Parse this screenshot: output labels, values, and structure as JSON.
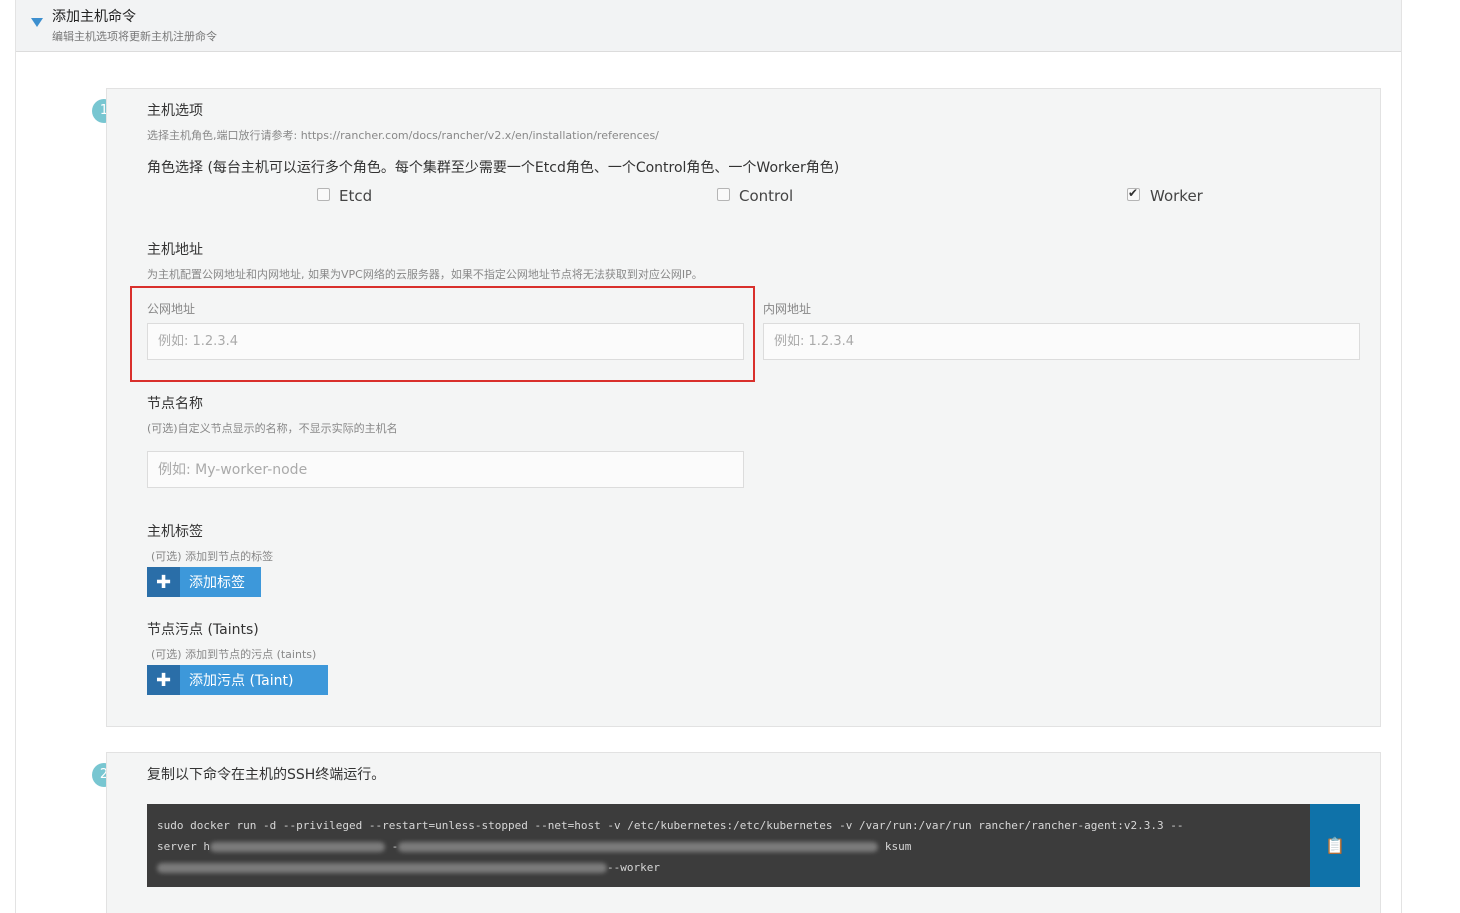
{
  "header": {
    "title": "添加主机命令",
    "subtitle": "编辑主机选项将更新主机注册命令"
  },
  "step1": {
    "badge": "1",
    "host_options": {
      "title": "主机选项",
      "hint": "选择主机角色,端口放行请参考: https://rancher.com/docs/rancher/v2.x/en/installation/references/"
    },
    "roles": {
      "title": "角色选择 (每台主机可以运行多个角色。每个集群至少需要一个Etcd角色、一个Control角色、一个Worker角色)",
      "items": [
        {
          "label": "Etcd",
          "checked": false
        },
        {
          "label": "Control",
          "checked": false
        },
        {
          "label": "Worker",
          "checked": true
        }
      ]
    },
    "address": {
      "title": "主机地址",
      "hint": "为主机配置公网地址和内网地址, 如果为VPC网络的云服务器，如果不指定公网地址节点将无法获取到对应公网IP。",
      "public_label": "公网地址",
      "public_placeholder": "例如: 1.2.3.4",
      "public_value": "",
      "private_label": "内网地址",
      "private_placeholder": "例如: 1.2.3.4",
      "private_value": ""
    },
    "node_name": {
      "title": "节点名称",
      "hint": "(可选)自定义节点显示的名称，不显示实际的主机名",
      "placeholder": "例如: My-worker-node",
      "value": ""
    },
    "labels": {
      "title": "主机标签",
      "hint": "(可选) 添加到节点的标签",
      "button": "添加标签"
    },
    "taints": {
      "title": "节点污点 (Taints)",
      "hint": "(可选) 添加到节点的污点 (taints)",
      "button": "添加污点 (Taint)"
    }
  },
  "step2": {
    "badge": "2",
    "title": "复制以下命令在主机的SSH终端运行。",
    "command_line1": "sudo docker run -d --privileged --restart=unless-stopped --net=host -v /etc/kubernetes:/etc/kubernetes -v /var/run:/var/run rancher/rancher-agent:v2.3.3 --",
    "command_line2_start": "server h",
    "command_line2_mid": "-",
    "command_line2_end": "ksum",
    "command_line3_end": "--worker"
  },
  "colors": {
    "accent": "#3d98da",
    "badge": "#78c6d1",
    "highlight": "#d9302c",
    "copy_button": "#0f72a9"
  }
}
